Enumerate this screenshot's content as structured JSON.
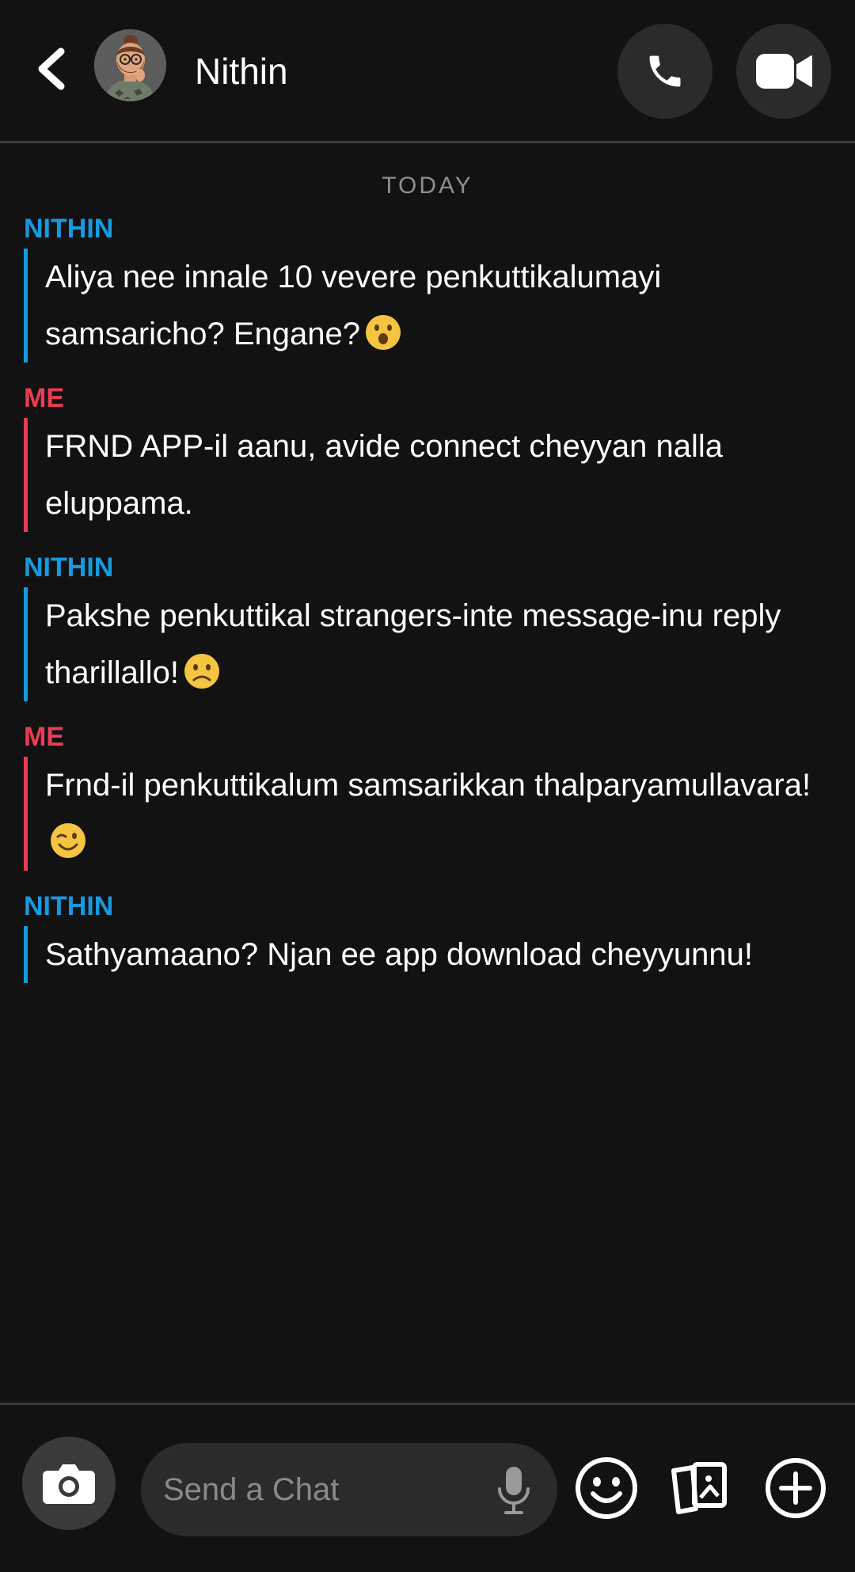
{
  "header": {
    "contact_name": "Nithin"
  },
  "conversation": {
    "day_label": "TODAY",
    "messages": [
      {
        "sender": "NITHIN",
        "side": "them",
        "text": "Aliya nee innale 10 vevere penkuttikalumayi samsaricho? Engane?",
        "emoji": "astonished-face"
      },
      {
        "sender": "ME",
        "side": "me",
        "text": "FRND APP-il aanu, avide connect cheyyan nalla eluppama.",
        "emoji": ""
      },
      {
        "sender": "NITHIN",
        "side": "them",
        "text": "Pakshe penkuttikal strangers-inte message-inu reply tharillallo!",
        "emoji": "slightly-frowning-face"
      },
      {
        "sender": "ME",
        "side": "me",
        "text": "Frnd-il penkuttikalum samsarikkan thalparyamullavara!",
        "emoji": "winking-face"
      },
      {
        "sender": "NITHIN",
        "side": "them",
        "text": "Sathyamaano? Njan ee app download cheyyunnu!",
        "emoji": ""
      }
    ]
  },
  "composer": {
    "placeholder": "Send a Chat"
  },
  "colors": {
    "background": "#121212",
    "them_accent": "#169ae0",
    "me_accent": "#eb3b55",
    "button_bg": "#2b2b2b"
  },
  "icons": {
    "back": "chevron-left-icon",
    "call": "phone-icon",
    "video": "video-camera-icon",
    "camera": "camera-icon",
    "mic": "microphone-icon",
    "emoji": "smiley-icon",
    "stickers": "stickers-icon",
    "plus": "plus-circle-icon"
  }
}
